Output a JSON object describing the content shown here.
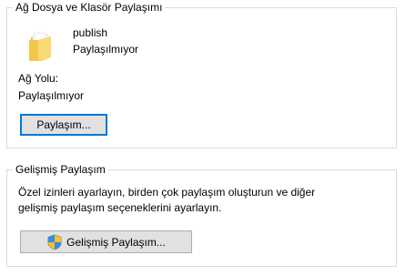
{
  "network_sharing": {
    "title": "Ağ Dosya ve Klasör Paylaşımı",
    "folder_icon": "folder-icon",
    "folder_name": "publish",
    "folder_status": "Paylaşılmıyor",
    "network_path_label": "Ağ Yolu:",
    "network_path_value": "Paylaşılmıyor",
    "share_button_label": "Paylaşım..."
  },
  "advanced_sharing": {
    "title": "Gelişmiş Paylaşım",
    "description_line1": "Özel izinleri ayarlayın, birden çok paylaşım oluşturun ve diğer",
    "description_line2": "gelişmiş paylaşım seçeneklerini ayarlayın.",
    "shield_icon": "uac-shield-icon",
    "advanced_button_label": "Gelişmiş Paylaşım..."
  },
  "colors": {
    "group_border": "#dcdcdc",
    "button_face": "#e1e1e1",
    "button_border": "#adadad",
    "focus_border": "#0078d7"
  }
}
